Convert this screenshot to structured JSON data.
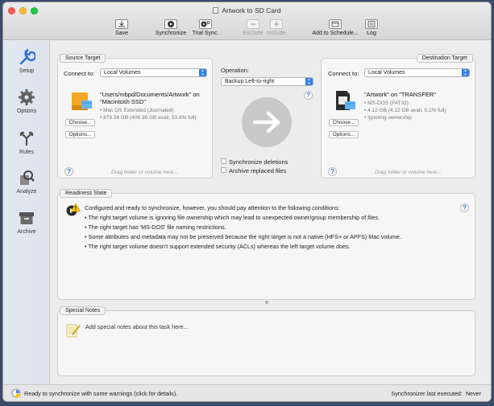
{
  "window": {
    "title": "Artwork to SD Card"
  },
  "toolbar": {
    "save": "Save",
    "synchronize": "Synchronize",
    "trial_sync": "Trial Sync.",
    "exclude": "Exclude",
    "include": "Include",
    "add_to_schedule": "Add to Schedule...",
    "log": "Log"
  },
  "sidebar": {
    "items": [
      {
        "label": "Setup",
        "icon": "wrench-icon"
      },
      {
        "label": "Options",
        "icon": "gear-icon"
      },
      {
        "label": "Rules",
        "icon": "rules-icon"
      },
      {
        "label": "Analyze",
        "icon": "analyze-icon"
      },
      {
        "label": "Archive",
        "icon": "archive-icon"
      }
    ]
  },
  "source": {
    "tab": "Source Target",
    "connect_label": "Connect to:",
    "connect_value": "Local Volumes",
    "name_line1": "\"Users/mbpd/Documents/Artwork\" on",
    "name_line2": "\"Macintosh SSD\"",
    "details": [
      "Mac OS Extended (Journaled)",
      "879.34 GB (406.38 GB avail, 53.8% full)"
    ],
    "choose": "Choose...",
    "options": "Options...",
    "drag_hint": "Drag folder or volume here...",
    "help": "?"
  },
  "operation": {
    "label": "Operation:",
    "value": "Backup Left-to-right",
    "help": "?",
    "sync_deletions": "Synchronize deletions",
    "archive_replaced": "Archive replaced files"
  },
  "destination": {
    "tab": "Destination Target",
    "connect_label": "Connect to:",
    "connect_value": "Local Volumes",
    "name_line1": "\"Artwork\" on \"TRANSFER\"",
    "details": [
      "MS-DOS (FAT32)",
      "4.12 GB (4.12 GB avail, 0.1% full)",
      "Ignoring ownership"
    ],
    "choose": "Choose...",
    "options": "Options...",
    "drag_hint": "Drag folder or volume here...",
    "help": "?"
  },
  "readiness": {
    "tab": "Readiness State",
    "summary": "Configured and ready to synchronize, however, you should pay attention to the following conditions:",
    "items": [
      "The right target volume is ignoring file ownership which may lead to unexpected owner/group membership of files.",
      "The right target has 'MS-DOS' file naming restrictions.",
      "Some attributes and metadata may not be preserved because the right target is not a native (HFS+ or APFS) Mac volume.",
      "The right target volume doesn't support extended security (ACLs) whereas the left target volume does."
    ],
    "help": "?"
  },
  "notes": {
    "tab": "Special Notes",
    "placeholder": "Add special notes about this task here..."
  },
  "status": {
    "message": "Ready to synchronize with some warnings (click for details).",
    "last_executed": "Synchronizer last executed:  Never"
  },
  "colors": {
    "accent": "#2f7ff2",
    "close": "#fc5f57",
    "minimize": "#fdbc2e",
    "zoom": "#28c840",
    "warning": "#f5c400"
  }
}
